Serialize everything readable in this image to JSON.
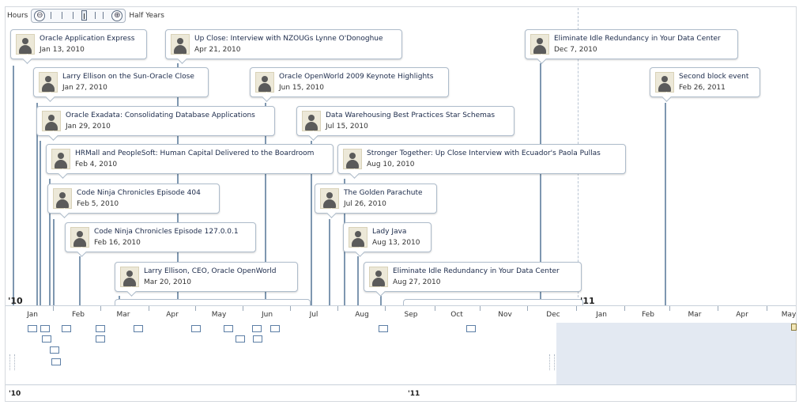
{
  "zoom": {
    "min_label": "Hours",
    "max_label": "Half Years",
    "zoom_out_glyph": "⊖",
    "zoom_in_glyph": "⊕"
  },
  "events": [
    {
      "title": "Oracle Application Express",
      "date": "Jan 13, 2010"
    },
    {
      "title": "Up Close: Interview with NZOUGs Lynne O'Donoghue",
      "date": "Apr 21, 2010"
    },
    {
      "title": "Eliminate Idle Redundancy in Your Data Center",
      "date": "Dec 7, 2010"
    },
    {
      "title": "Larry Ellison on the Sun-Oracle Close",
      "date": "Jan 27, 2010"
    },
    {
      "title": "Oracle OpenWorld 2009 Keynote Highlights",
      "date": "Jun 15, 2010"
    },
    {
      "title": "Second block event",
      "date": "Feb 26, 2011"
    },
    {
      "title": "Oracle Exadata: Consolidating Database Applications",
      "date": "Jan 29, 2010"
    },
    {
      "title": "Data Warehousing Best Practices Star Schemas",
      "date": "Jul 15, 2010"
    },
    {
      "title": "HRMall and PeopleSoft: Human Capital Delivered to the Boardroom",
      "date": "Feb 4, 2010"
    },
    {
      "title": "Stronger Together: Up Close Interview with Ecuador's Paola Pullas",
      "date": "Aug 10, 2010"
    },
    {
      "title": "Code Ninja Chronicles Episode 404",
      "date": "Feb 5, 2010"
    },
    {
      "title": "The Golden Parachute",
      "date": "Jul 26, 2010"
    },
    {
      "title": "Code Ninja Chronicles Episode 127.0.0.1",
      "date": "Feb 16, 2010"
    },
    {
      "title": "Lady Java",
      "date": "Aug 13, 2010"
    },
    {
      "title": "Larry Ellison, CEO, Oracle OpenWorld",
      "date": "Mar 20, 2010"
    },
    {
      "title": "Eliminate Idle Redundancy in Your Data Center",
      "date": "Aug 27, 2010"
    }
  ],
  "years": {
    "y1": "'10",
    "y2": "'11"
  },
  "months": [
    "Jan",
    "Feb",
    "Mar",
    "Apr",
    "May",
    "Jun",
    "Jul",
    "Aug",
    "Sep",
    "Oct",
    "Nov",
    "Dec",
    "Jan",
    "Feb",
    "Mar",
    "Apr",
    "May"
  ],
  "overview_years": {
    "y1": "'10",
    "y2": "'11"
  }
}
